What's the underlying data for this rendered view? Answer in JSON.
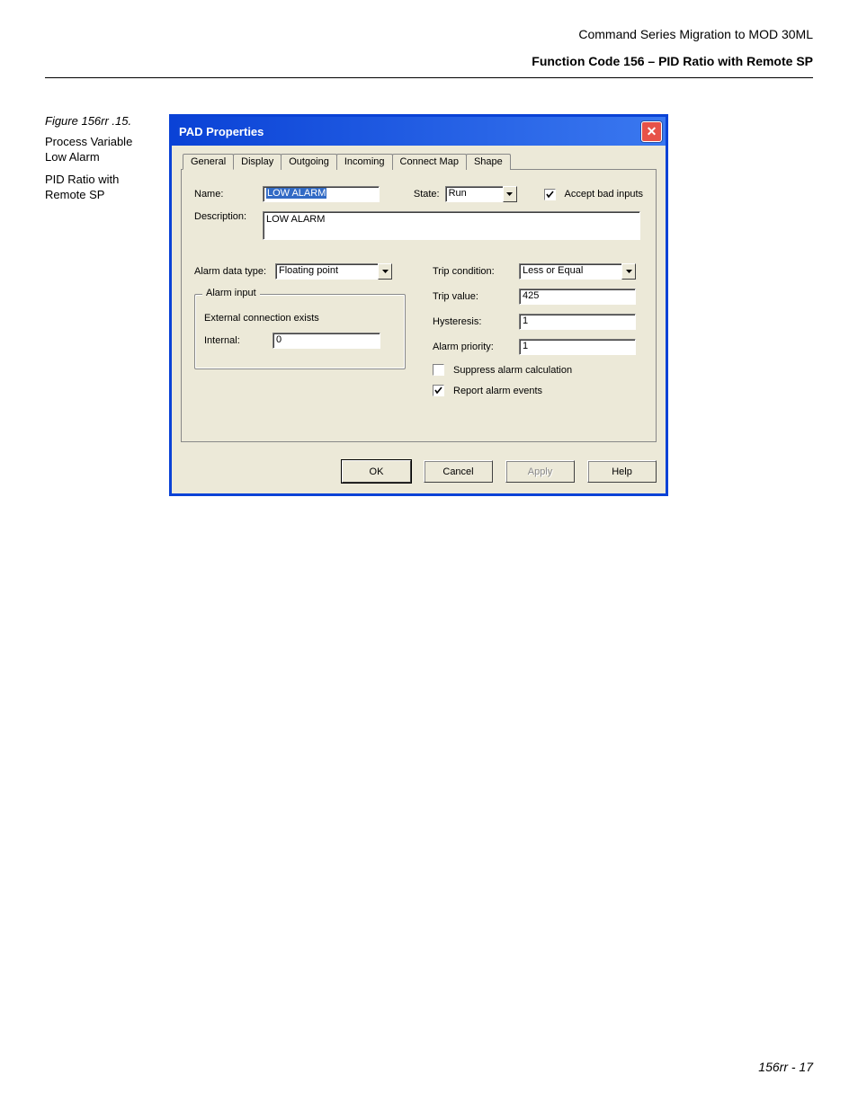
{
  "header": {
    "doc_title": "Command Series Migration to MOD 30ML",
    "section_title": "Function Code 156 – PID Ratio with Remote SP"
  },
  "caption": {
    "figure": "Figure 156rr .15.",
    "line1": "Process Variable Low Alarm",
    "line2": "PID Ratio with Remote SP"
  },
  "dialog": {
    "title": "PAD Properties",
    "tabs": [
      "General",
      "Display",
      "Outgoing",
      "Incoming",
      "Connect Map",
      "Shape"
    ],
    "active_tab": 0,
    "labels": {
      "name": "Name:",
      "state": "State:",
      "accept_bad_inputs": "Accept bad inputs",
      "description": "Description:",
      "alarm_data_type": "Alarm data type:",
      "alarm_input_group": "Alarm input",
      "external_note": "External connection exists",
      "internal": "Internal:",
      "trip_condition": "Trip condition:",
      "trip_value": "Trip value:",
      "hysteresis": "Hysteresis:",
      "alarm_priority": "Alarm priority:",
      "suppress": "Suppress alarm calculation",
      "report_events": "Report alarm events"
    },
    "values": {
      "name": "LOW ALARM",
      "state": "Run",
      "accept_bad_inputs_checked": true,
      "description": "LOW  ALARM",
      "alarm_data_type": "Floating point",
      "internal": "0",
      "trip_condition": "Less or Equal",
      "trip_value": "425",
      "hysteresis": "1",
      "alarm_priority": "1",
      "suppress_checked": false,
      "report_events_checked": true
    },
    "buttons": {
      "ok": "OK",
      "cancel": "Cancel",
      "apply": "Apply",
      "help": "Help"
    }
  },
  "footer": "156rr - 17"
}
